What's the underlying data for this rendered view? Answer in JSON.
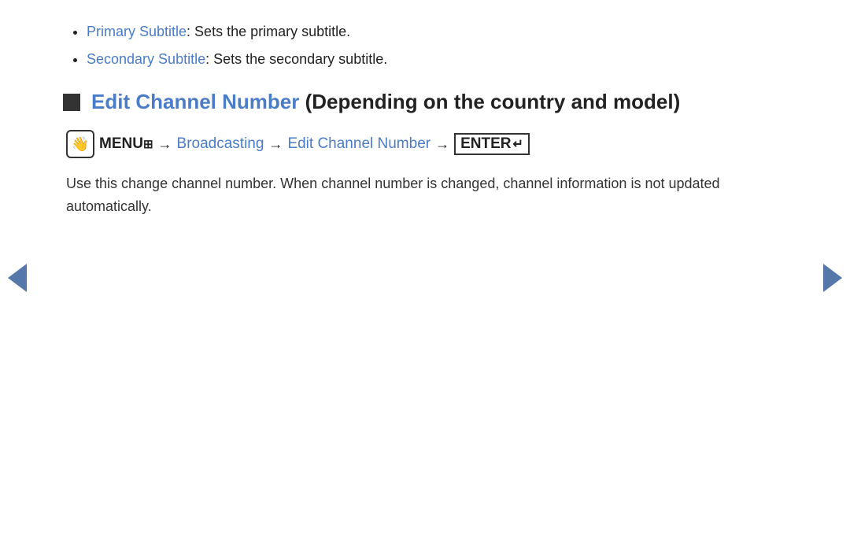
{
  "bullets": [
    {
      "link_text": "Primary Subtitle",
      "rest_text": ": Sets the primary subtitle."
    },
    {
      "link_text": "Secondary Subtitle",
      "rest_text": ": Sets the secondary subtitle."
    }
  ],
  "section": {
    "title_blue": "Edit Channel Number",
    "title_black": " (Depending on the country and model)",
    "menu_label": "MENU",
    "menu_grid": "⊞",
    "arrow": "→",
    "breadcrumb_1": "Broadcasting",
    "breadcrumb_2": "Edit Channel Number",
    "enter_label": "ENTER",
    "enter_symbol": "↵",
    "description": "Use this change channel number. When channel number is changed, channel information is not updated automatically."
  },
  "nav": {
    "left_label": "◄",
    "right_label": "►"
  }
}
